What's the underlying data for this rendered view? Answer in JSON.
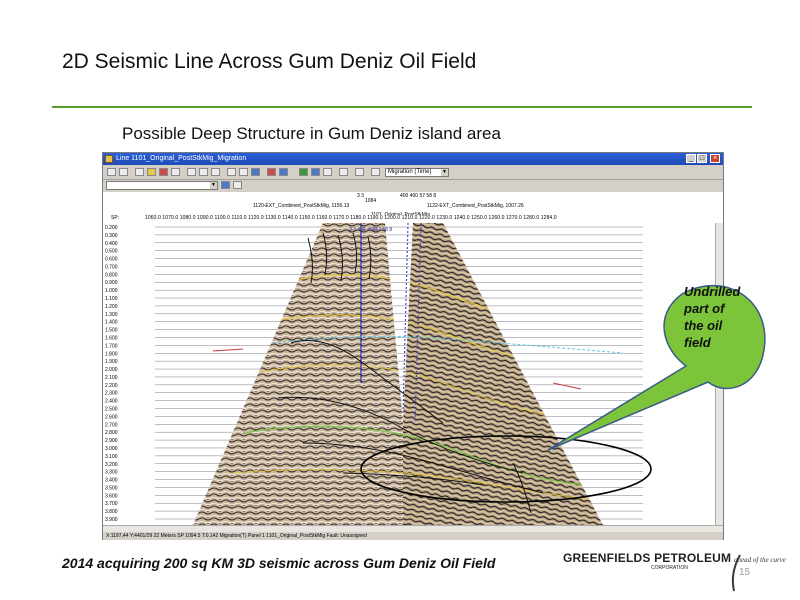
{
  "slide": {
    "title": "2D Seismic Line Across Gum Deniz Oil Field",
    "subtitle": "Possible Deep Structure in Gum Deniz island area",
    "footer": "2014 acquiring 200 sq KM 3D seismic across Gum Deniz Oil Field",
    "page_number": "15",
    "accent_color": "#5a9e2a"
  },
  "app_window": {
    "title": "Line 1101_Original_PostStkMig_Migration",
    "toolbar": {
      "display_select": "Migration (Time)"
    },
    "header": {
      "top_numbers": "3 3",
      "top_numbers_right": "400 400  57 58 8",
      "marker_label": "1084",
      "left_line_label": "1120-EXT_Combined_PostStkMig, 1155.13",
      "right_line_label": "1122-EXT_Combined_PostStkMig, 1007.26",
      "center_line_label": "1101_Original_PostStkMig",
      "sp_label": "SP:",
      "sp_values": "1060.0  1070.0  1080.0  1090.0  1100.0  1110.0  1120.0  1130.0  1140.0  1150.0  1160.0  1170.0  1180.0  1190.0  1200.0  1210.0  1220.0  1230.0  1240.0  1250.0  1260.0  1270.0  1280.0  1284.0",
      "plot_top_label": "3 3      409 40857 58 8"
    },
    "time_axis": [
      "0.200",
      "0.300",
      "0.400",
      "0.500",
      "0.600",
      "0.700",
      "0.800",
      "0.900",
      "1.000",
      "1.100",
      "1.200",
      "1.300",
      "1.400",
      "1.500",
      "1.600",
      "1.700",
      "1.800",
      "1.900",
      "2.000",
      "2.100",
      "2.200",
      "2.300",
      "2.400",
      "2.500",
      "2.600",
      "2.700",
      "2.800",
      "2.900",
      "3.000",
      "3.100",
      "3.200",
      "3.300",
      "3.400",
      "3.500",
      "3.600",
      "3.700",
      "3.800",
      "3.900"
    ],
    "status_bar": "X:1197,44   Y:4401/29 22 Meters   SP 1094.5   T:0.142   Migration(T)   Panel 1   1101_Original_PostStkMig   Fault: Unassigned"
  },
  "callout": {
    "text_lines": [
      "Undrilled",
      "part of",
      "the oil",
      "field"
    ],
    "fill_color": "#7cc43a"
  },
  "logo": {
    "name": "GREENFIELDS PETROLEUM",
    "corporation": "CORPORATION",
    "tagline": "ahead of the curve"
  }
}
